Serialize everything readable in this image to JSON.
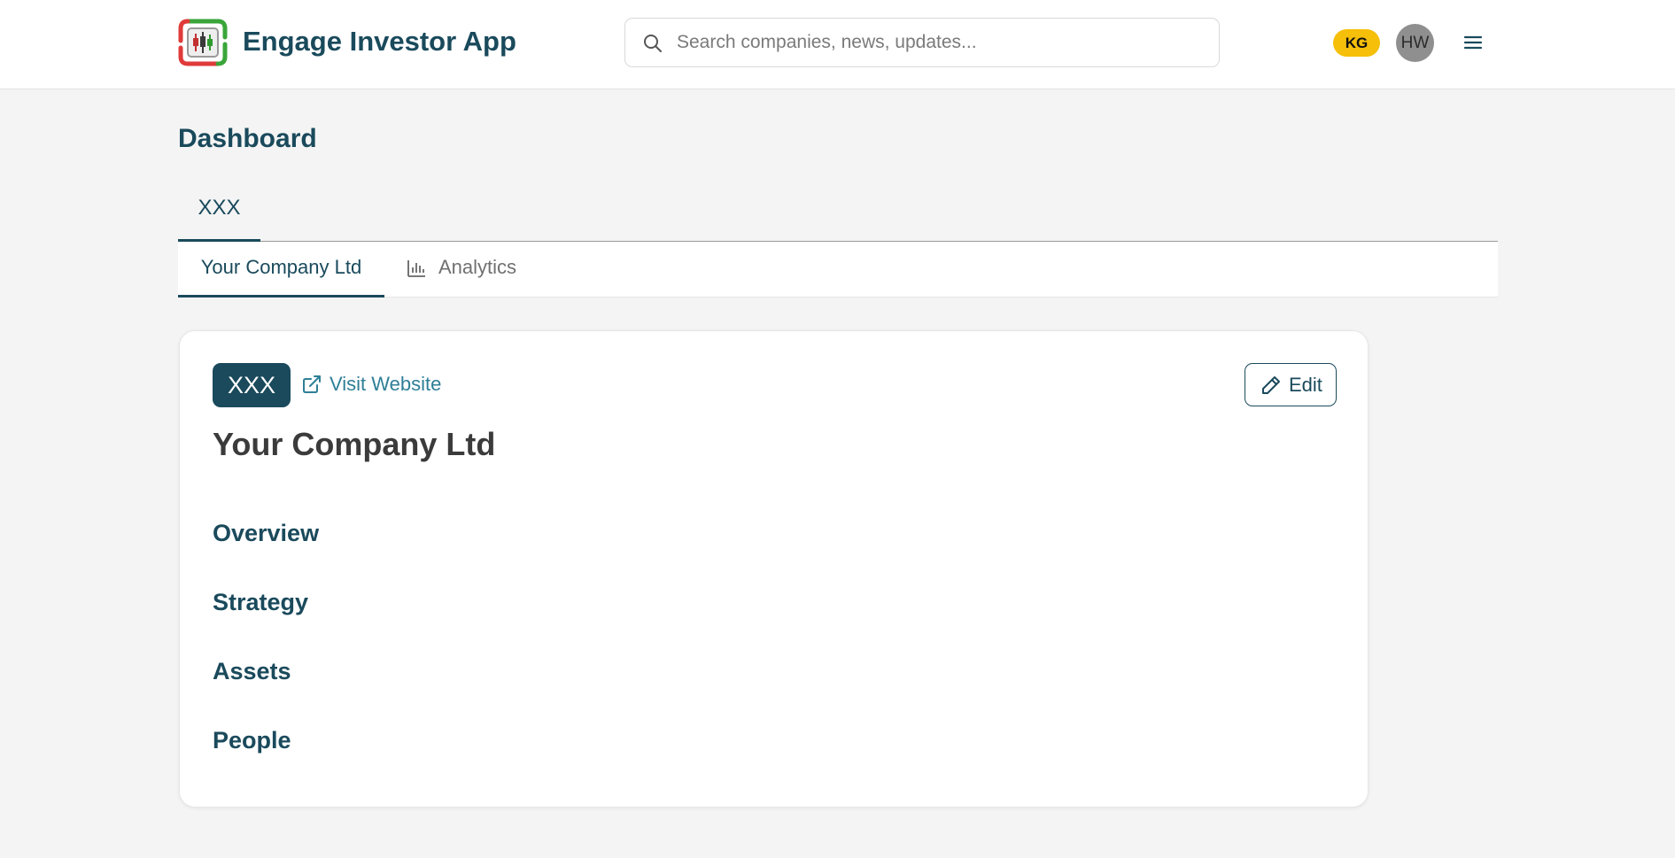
{
  "header": {
    "app_title": "Engage Investor App",
    "search_placeholder": "Search companies, news, updates...",
    "badge": "KG",
    "avatar_initials": "HW"
  },
  "page": {
    "title": "Dashboard"
  },
  "top_tabs": [
    {
      "label": "XXX",
      "active": true
    }
  ],
  "sub_tabs": [
    {
      "label": "Your Company Ltd",
      "active": true
    },
    {
      "label": "Analytics",
      "icon": "bar-chart-icon",
      "active": false
    }
  ],
  "company": {
    "ticker": "XXX",
    "visit_label": "Visit Website",
    "edit_label": "Edit",
    "name": "Your Company Ltd",
    "sections": [
      "Overview",
      "Strategy",
      "Assets",
      "People"
    ]
  },
  "colors": {
    "primary": "#1a4a5c",
    "link": "#2f7f97",
    "badge": "#f5bf0a",
    "background": "#f4f4f4"
  }
}
